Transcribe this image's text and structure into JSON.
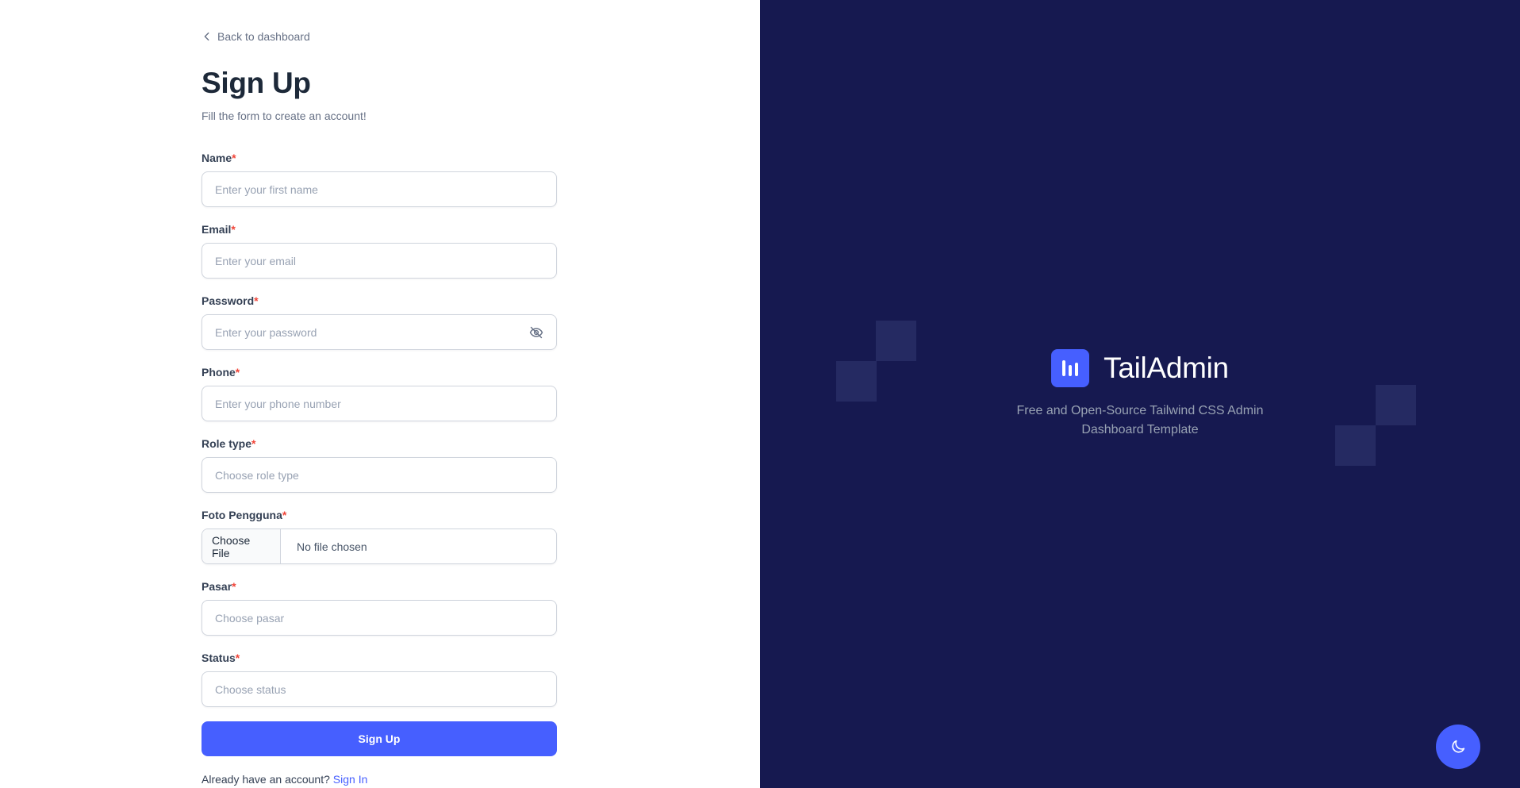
{
  "nav": {
    "back_label": "Back to dashboard"
  },
  "header": {
    "title": "Sign Up",
    "subtitle": "Fill the form to create an account!"
  },
  "form": {
    "name": {
      "label": "Name",
      "placeholder": "Enter your first name"
    },
    "email": {
      "label": "Email",
      "placeholder": "Enter your email"
    },
    "password": {
      "label": "Password",
      "placeholder": "Enter your password",
      "toggle_icon": "eye-off-icon"
    },
    "phone": {
      "label": "Phone",
      "placeholder": "Enter your phone number"
    },
    "role_type": {
      "label": "Role type",
      "placeholder": "Choose role type"
    },
    "foto": {
      "label": "Foto Pengguna",
      "button_label": "Choose File",
      "status": "No file chosen"
    },
    "pasar": {
      "label": "Pasar",
      "placeholder": "Choose pasar"
    },
    "status": {
      "label": "Status",
      "placeholder": "Choose status"
    },
    "required_marker": "*",
    "submit_label": "Sign Up"
  },
  "footer": {
    "prompt": "Already have an account?",
    "signin_label": "Sign In"
  },
  "brand": {
    "name": "TailAdmin",
    "tagline": "Free and Open-Source Tailwind CSS Admin Dashboard Template",
    "logo_icon": "bar-chart-logo-icon"
  },
  "theme_toggle": {
    "icon": "moon-icon"
  },
  "colors": {
    "accent": "#465fff",
    "panel_bg": "#161950",
    "required": "#f04438",
    "text_dark": "#1d2939",
    "text_muted": "#667085"
  }
}
